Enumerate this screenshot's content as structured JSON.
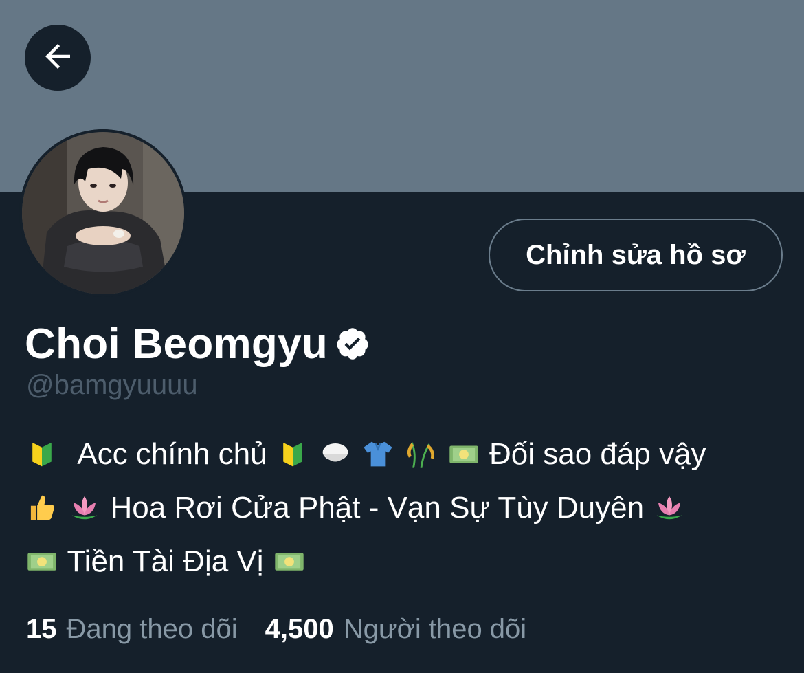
{
  "header": {
    "banner_color": "#657786",
    "back_icon": "arrow-left-icon"
  },
  "profile": {
    "display_name": "Choi Beomgyu",
    "verified_icon": "verified-badge-icon",
    "handle": "@bamgyuuuu",
    "edit_button_label": "Chỉnh sửa hồ sơ",
    "bio": {
      "line1_text_a": "Acc chính chủ",
      "line1_text_b": "Đối sao đáp vậy",
      "line2_text": "Hoa Rơi Cửa Phật - Vạn Sự Tùy Duyên",
      "line3_text": "Tiền Tài Địa Vị"
    },
    "bio_icons": [
      "beginner-badge-icon",
      "rice-bowl-icon",
      "shirt-icon",
      "rice-plant-icon",
      "money-bill-icon",
      "thumbs-up-icon",
      "lotus-icon"
    ]
  },
  "stats": {
    "following_count": "15",
    "following_label": "Đang theo dõi",
    "followers_count": "4,500",
    "followers_label": "Người theo dõi"
  },
  "colors": {
    "background": "#15202b",
    "secondary_text": "#8899a6",
    "handle_text": "#4d5d6c"
  }
}
